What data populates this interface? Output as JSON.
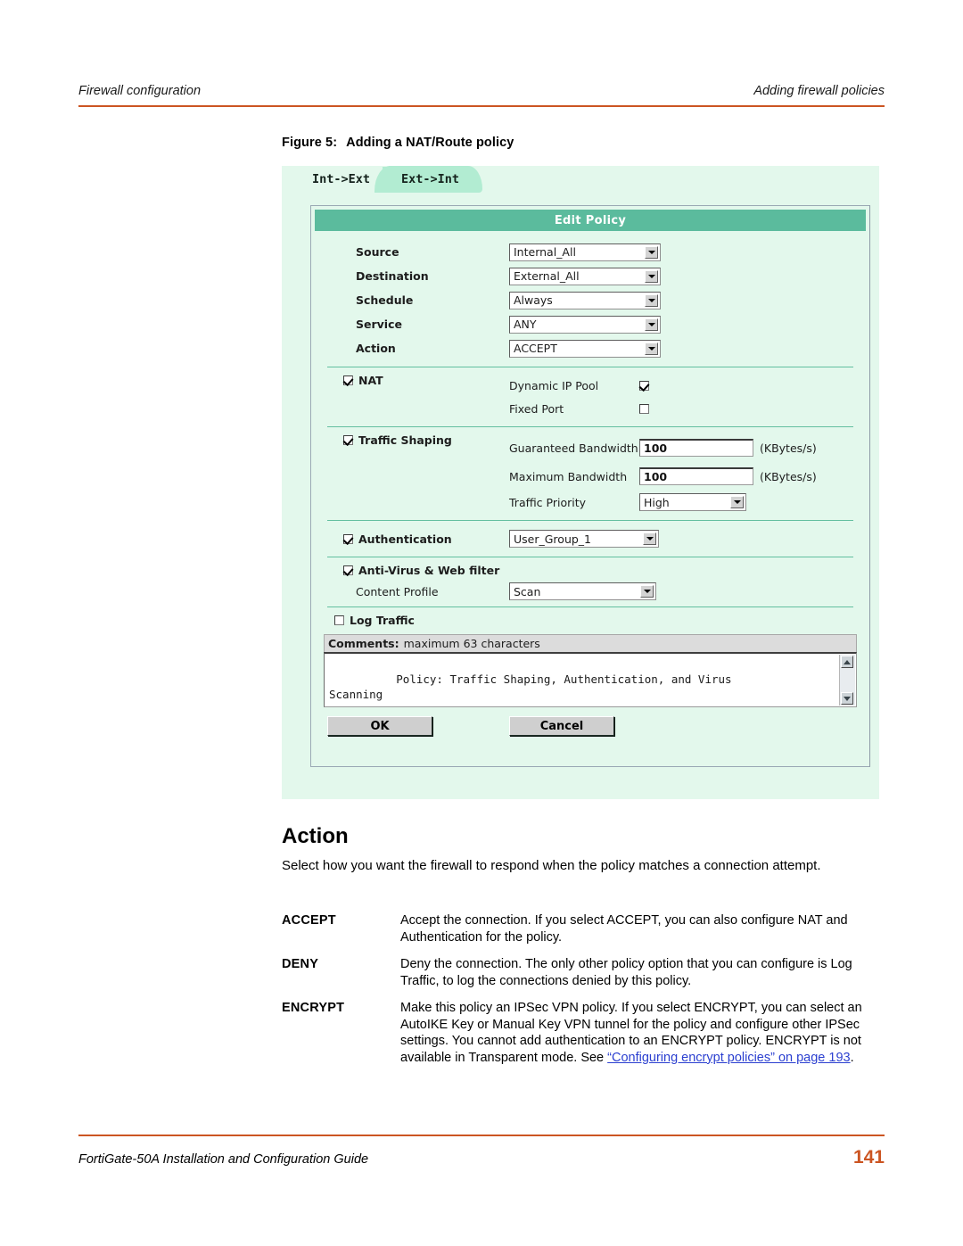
{
  "header": {
    "left": "Firewall configuration",
    "right": "Adding firewall policies",
    "rule_color": "#cc5522"
  },
  "figure": {
    "number": "Figure 5:",
    "caption": "Adding a NAT/Route policy",
    "background": "#e3f8ec",
    "titlebar_color": "#5bbb9d"
  },
  "tabs": [
    {
      "label": "Int->Ext",
      "active": false
    },
    {
      "label": "Ext->Int",
      "active": true
    }
  ],
  "panel": {
    "title": "Edit Policy",
    "fields": [
      {
        "label": "Source",
        "value": "Internal_All"
      },
      {
        "label": "Destination",
        "value": "External_All"
      },
      {
        "label": "Schedule",
        "value": "Always"
      },
      {
        "label": "Service",
        "value": "ANY"
      },
      {
        "label": "Action",
        "value": "ACCEPT"
      }
    ],
    "nat": {
      "label": "NAT",
      "checked": true,
      "dynamic_ip_pool_label": "Dynamic IP Pool",
      "dynamic_ip_pool_checked": true,
      "fixed_port_label": "Fixed Port",
      "fixed_port_checked": false
    },
    "traffic_shaping": {
      "label": "Traffic Shaping",
      "checked": true,
      "guaranteed_label": "Guaranteed Bandwidth",
      "guaranteed_value": "100",
      "guaranteed_unit": "(KBytes/s)",
      "maximum_label": "Maximum Bandwidth",
      "maximum_value": "100",
      "maximum_unit": "(KBytes/s)",
      "priority_label": "Traffic Priority",
      "priority_value": "High"
    },
    "authentication": {
      "label": "Authentication",
      "checked": true,
      "value": "User_Group_1"
    },
    "antivirus": {
      "label": "Anti-Virus & Web filter",
      "checked": true,
      "content_profile_label": "Content Profile",
      "content_profile_value": "Scan"
    },
    "log_traffic": {
      "label": "Log Traffic",
      "checked": false
    },
    "comments": {
      "head_bold": "Comments:",
      "head_rest": "maximum 63 characters",
      "value": "Policy: Traffic Shaping, Authentication, and Virus\nScanning"
    },
    "buttons": {
      "ok": "OK",
      "cancel": "Cancel"
    }
  },
  "body": {
    "section_title": "Action",
    "intro": "Select how you want the firewall to respond when the policy matches a connection attempt.",
    "definitions": [
      {
        "term": "ACCEPT",
        "desc": "Accept the connection. If you select ACCEPT, you can also configure NAT and Authentication for the policy."
      },
      {
        "term": "DENY",
        "desc": "Deny the connection. The only other policy option that you can configure is Log Traffic, to log the connections denied by this policy."
      },
      {
        "term": "ENCRYPT",
        "desc_before": "Make this policy an IPSec VPN policy. If you select ENCRYPT, you can select an AutoIKE Key or Manual Key VPN tunnel for the policy and configure other IPSec settings. You cannot add authentication to an ENCRYPT policy. ENCRYPT is not available in Transparent mode. See ",
        "link": "“Configuring encrypt policies” on page 193",
        "link_color": "#2b3fd0",
        "desc_after": "."
      }
    ]
  },
  "footer": {
    "text": "FortiGate-50A Installation and Configuration Guide",
    "page": "141",
    "page_color": "#cc5522"
  }
}
